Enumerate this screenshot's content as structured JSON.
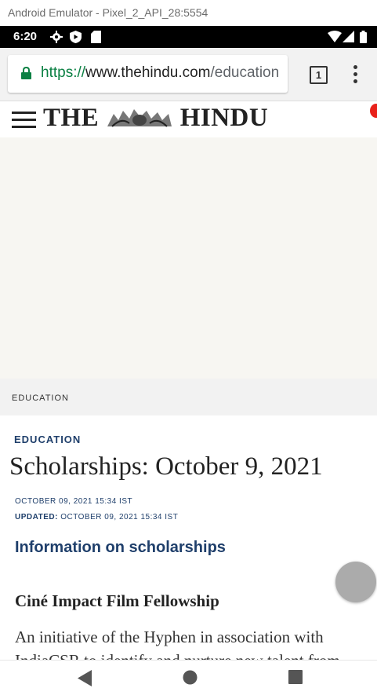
{
  "emulator": {
    "title": "Android Emulator - Pixel_2_API_28:5554"
  },
  "status_bar": {
    "time": "6:20",
    "icons": [
      "settings-icon",
      "shield-icon",
      "sd-card-icon",
      "wifi-icon",
      "signal-icon",
      "battery-icon"
    ]
  },
  "browser": {
    "url_scheme": "https://",
    "url_host": "www.thehindu.com",
    "url_path": "/education",
    "tab_count": "1"
  },
  "site": {
    "logo_left": "THE",
    "logo_right": "HINDU",
    "section_label": "EDUCATION"
  },
  "article": {
    "kicker": "EDUCATION",
    "headline": "Scholarships: October 9, 2021",
    "published": "OCTOBER 09, 2021 15:34 IST",
    "updated_label": "UPDATED:",
    "updated": "OCTOBER 09, 2021 15:34 IST",
    "subhead": "Information on scholarships",
    "item_title": "Ciné Impact Film Fellowship",
    "item_body": "An initiative of the Hyphen in association with IndiaCSR to identify and nurture new talent from"
  },
  "colors": {
    "accent_navy": "#1f3f6b",
    "secure_green": "#0b8043",
    "notification_red": "#e8211a"
  }
}
